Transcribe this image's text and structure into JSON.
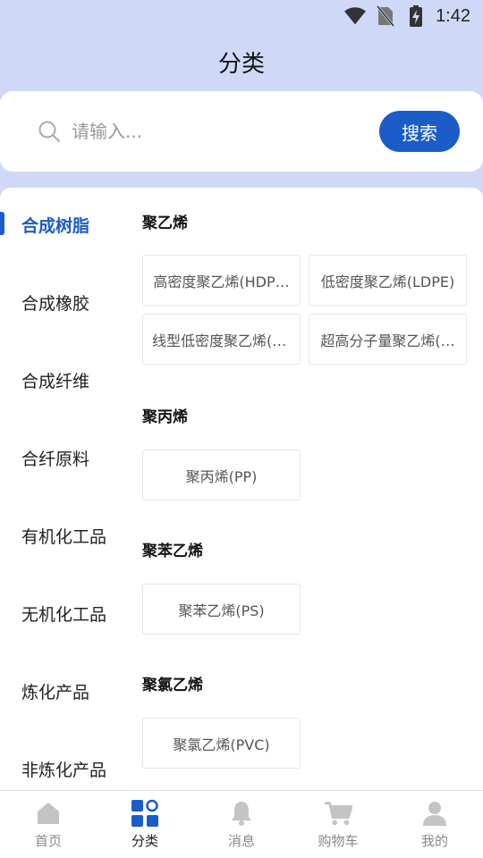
{
  "status_bar": {
    "time": "1:42"
  },
  "header": {
    "title": "分类"
  },
  "search": {
    "placeholder": "请输入...",
    "button_label": "搜索"
  },
  "sidebar": {
    "items": [
      {
        "label": "合成树脂",
        "active": true
      },
      {
        "label": "合成橡胶"
      },
      {
        "label": "合成纤维"
      },
      {
        "label": "合纤原料"
      },
      {
        "label": "有机化工品"
      },
      {
        "label": "无机化工品"
      },
      {
        "label": "炼化产品"
      },
      {
        "label": "非炼化产品"
      }
    ]
  },
  "content": {
    "groups": [
      {
        "title": "聚乙烯",
        "chips": [
          "高密度聚乙烯(HDP…",
          "低密度聚乙烯(LDPE)",
          "线型低密度聚乙烯(L…",
          "超高分子量聚乙烯(…"
        ]
      },
      {
        "title": "聚丙烯",
        "chips": [
          "聚丙烯(PP)"
        ]
      },
      {
        "title": "聚苯乙烯",
        "chips": [
          "聚苯乙烯(PS)"
        ]
      },
      {
        "title": "聚氯乙烯",
        "chips": [
          "聚氯乙烯(PVC)"
        ]
      }
    ]
  },
  "tab_bar": {
    "tabs": [
      {
        "label": "首页",
        "icon": "home-icon"
      },
      {
        "label": "分类",
        "icon": "category-icon",
        "active": true
      },
      {
        "label": "消息",
        "icon": "bell-icon"
      },
      {
        "label": "购物车",
        "icon": "cart-icon"
      },
      {
        "label": "我的",
        "icon": "user-icon"
      }
    ]
  },
  "colors": {
    "accent": "#1b5cc9",
    "background": "#cfd9f7",
    "tab_inactive": "#c4c4c4"
  }
}
